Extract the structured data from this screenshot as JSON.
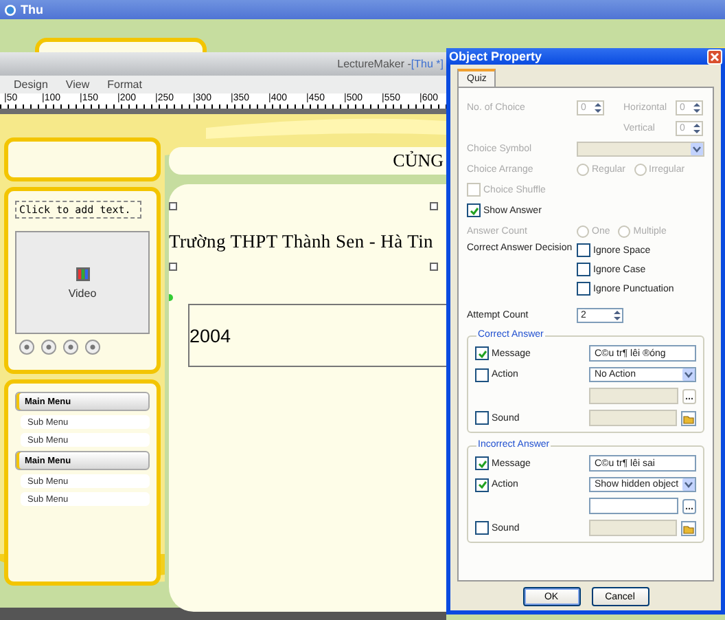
{
  "app_window": {
    "title": "Thu"
  },
  "editor": {
    "title": "LectureMaker - ",
    "document": "[Thu *]",
    "menu": [
      {
        "label": "Design"
      },
      {
        "label": "View"
      },
      {
        "label": "Format"
      }
    ],
    "ruler": [
      "|50",
      "|100",
      "|150",
      "|200",
      "|250",
      "|300",
      "|350",
      "|400",
      "|450",
      "|500",
      "|550",
      "|600"
    ]
  },
  "slide": {
    "header": "CỦNG",
    "placeholder": "Click to add text.",
    "video_label": "Video",
    "school": "Trường THPT Thành Sen - Hà Tin",
    "year": "2004",
    "menu": [
      {
        "label": "Main Menu",
        "kind": "main"
      },
      {
        "label": "Sub Menu",
        "kind": "sub"
      },
      {
        "label": "Sub Menu",
        "kind": "sub"
      },
      {
        "label": "Main Menu",
        "kind": "main"
      },
      {
        "label": "Sub Menu",
        "kind": "sub"
      },
      {
        "label": "Sub Menu",
        "kind": "sub"
      }
    ]
  },
  "dialog": {
    "title": "Object Property",
    "tabs": [
      {
        "label": "Quiz",
        "selected": true
      }
    ],
    "choice_count": {
      "label": "No. of Choice",
      "value": "0",
      "disabled": true
    },
    "horizontal": {
      "label": "Horizontal",
      "value": "0",
      "disabled": true
    },
    "vertical": {
      "label": "Vertical",
      "value": "0",
      "disabled": true
    },
    "choice_symbol": {
      "label": "Choice Symbol",
      "disabled": true
    },
    "choice_arrange": {
      "label": "Choice Arrange",
      "disabled": true,
      "options": [
        {
          "label": "Regular",
          "selected": false
        },
        {
          "label": "Irregular",
          "selected": false
        }
      ]
    },
    "choice_shuffle": {
      "label": "Choice Shuffle",
      "checked": false,
      "disabled": true
    },
    "show_answer": {
      "label": "Show Answer",
      "checked": true,
      "disabled": false
    },
    "answer_count": {
      "label": "Answer Count",
      "disabled": true,
      "options": [
        {
          "label": "One",
          "selected": false
        },
        {
          "label": "Multiple",
          "selected": false
        }
      ]
    },
    "decision": {
      "label": "Correct Answer Decision",
      "options": [
        {
          "label": "Ignore Space",
          "checked": false
        },
        {
          "label": "Ignore Case",
          "checked": false
        },
        {
          "label": "Ignore Punctuation",
          "checked": false
        }
      ]
    },
    "attempt_count": {
      "label": "Attempt Count",
      "value": "2"
    },
    "groups": [
      {
        "title": "Correct Answer",
        "message": {
          "label": "Message",
          "checked": true,
          "value": "C©u tr¶ lêi ®óng"
        },
        "action": {
          "label": "Action",
          "checked": false,
          "value": "No Action"
        },
        "target": {
          "disabled": true
        },
        "sound": {
          "label": "Sound",
          "checked": false
        }
      },
      {
        "title": "Incorrect Answer",
        "message": {
          "label": "Message",
          "checked": true,
          "value": "C©u tr¶ lêi sai"
        },
        "action": {
          "label": "Action",
          "checked": true,
          "value": "Show hidden object"
        },
        "target": {
          "disabled": false
        },
        "sound": {
          "label": "Sound",
          "checked": false
        }
      }
    ],
    "buttons": [
      "OK",
      "Cancel"
    ]
  }
}
